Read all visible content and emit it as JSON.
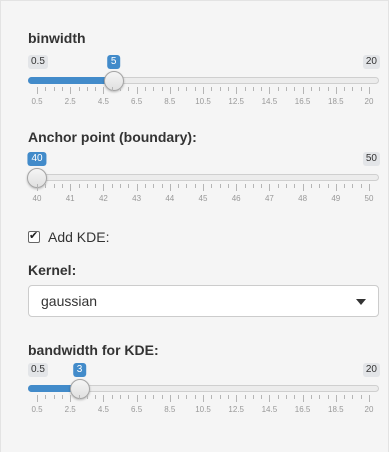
{
  "sliders": [
    {
      "label": "binwidth",
      "min_label": "0.5",
      "max_label": "20",
      "value_label": "5",
      "value": 5,
      "min": 0.5,
      "max": 20,
      "fill": true,
      "tick_labels": [
        "0.5",
        "2.5",
        "4.5",
        "6.5",
        "8.5",
        "10.5",
        "12.5",
        "14.5",
        "16.5",
        "18.5",
        "20"
      ]
    },
    {
      "label": "Anchor point (boundary):",
      "min_label": "40",
      "max_label": "50",
      "value_label": "40",
      "value": 40,
      "min": 40,
      "max": 50,
      "fill": false,
      "tick_labels": [
        "40",
        "41",
        "42",
        "43",
        "44",
        "45",
        "46",
        "47",
        "48",
        "49",
        "50"
      ]
    },
    {
      "label": "bandwidth for KDE:",
      "min_label": "0.5",
      "max_label": "20",
      "value_label": "3",
      "value": 3,
      "min": 0.5,
      "max": 20,
      "fill": true,
      "tick_labels": [
        "0.5",
        "2.5",
        "4.5",
        "6.5",
        "8.5",
        "10.5",
        "12.5",
        "14.5",
        "16.5",
        "18.5",
        "20"
      ]
    }
  ],
  "kde_checkbox": {
    "label": "Add KDE:",
    "checked": true
  },
  "kernel": {
    "label": "Kernel:",
    "value": "gaussian"
  },
  "colors": {
    "accent": "#428bca",
    "panel": "#f5f5f5"
  }
}
